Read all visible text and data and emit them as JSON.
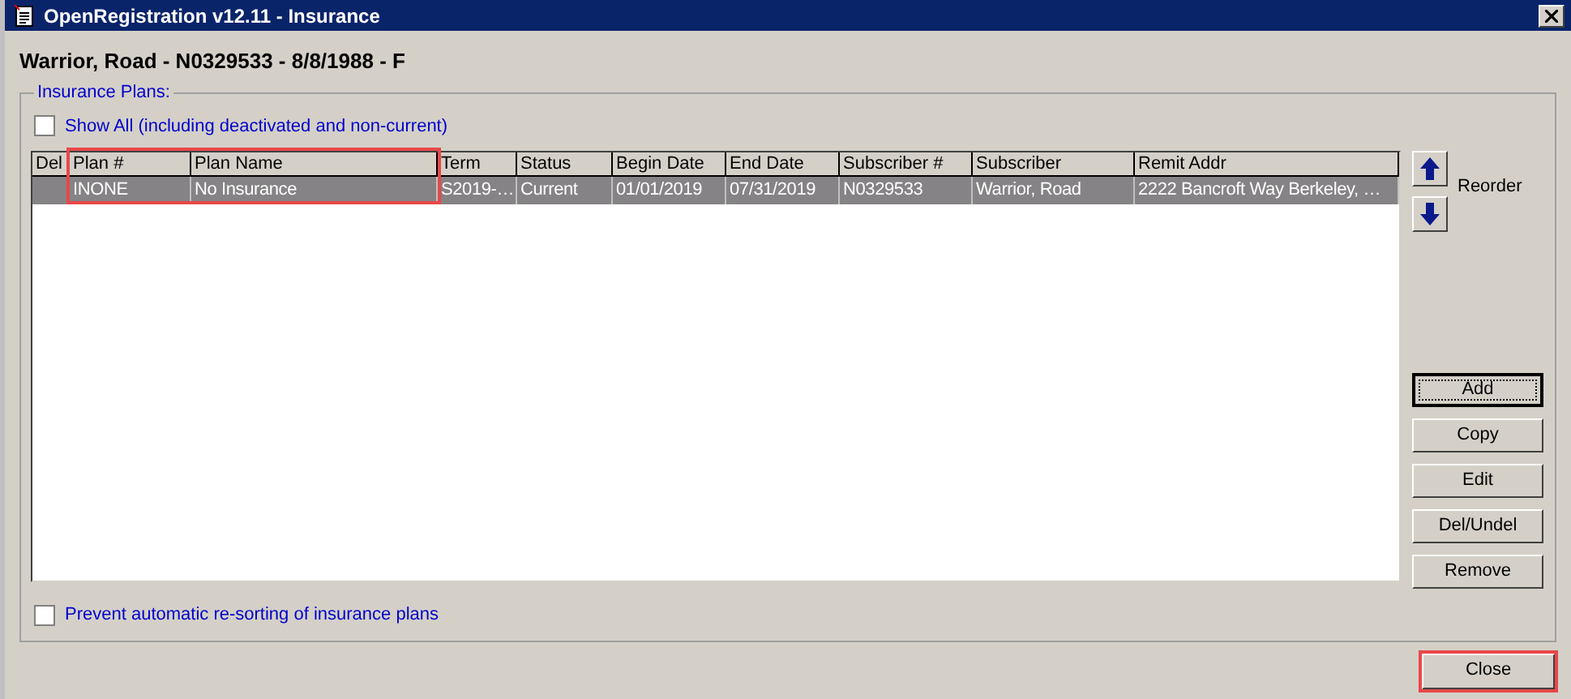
{
  "window": {
    "title": "OpenRegistration v12.11 - Insurance"
  },
  "patient_header": "Warrior, Road - N0329533 - 8/8/1988 - F",
  "group": {
    "title": "Insurance Plans:"
  },
  "show_all": {
    "label": "Show All (including deactivated and non-current)",
    "checked": false
  },
  "table": {
    "columns": [
      "Del",
      "Plan #",
      "Plan Name",
      "Term",
      "Status",
      "Begin Date",
      "End Date",
      "Subscriber #",
      "Subscriber",
      "Remit Addr"
    ],
    "rows": [
      {
        "selected": true,
        "cells": [
          "",
          "INONE",
          "No Insurance",
          "S2019-…",
          "Current",
          "01/01/2019",
          "07/31/2019",
          "N0329533",
          "Warrior, Road",
          "2222 Bancroft Way Berkeley, …"
        ]
      }
    ]
  },
  "reorder_label": "Reorder",
  "side_buttons": [
    {
      "label": "Add",
      "focused": true
    },
    {
      "label": "Copy",
      "focused": false
    },
    {
      "label": "Edit",
      "focused": false
    },
    {
      "label": "Del/Undel",
      "focused": false
    },
    {
      "label": "Remove",
      "focused": false
    }
  ],
  "prevent_resort": {
    "label": "Prevent automatic re-sorting of insurance plans",
    "checked": false
  },
  "close_button": "Close"
}
